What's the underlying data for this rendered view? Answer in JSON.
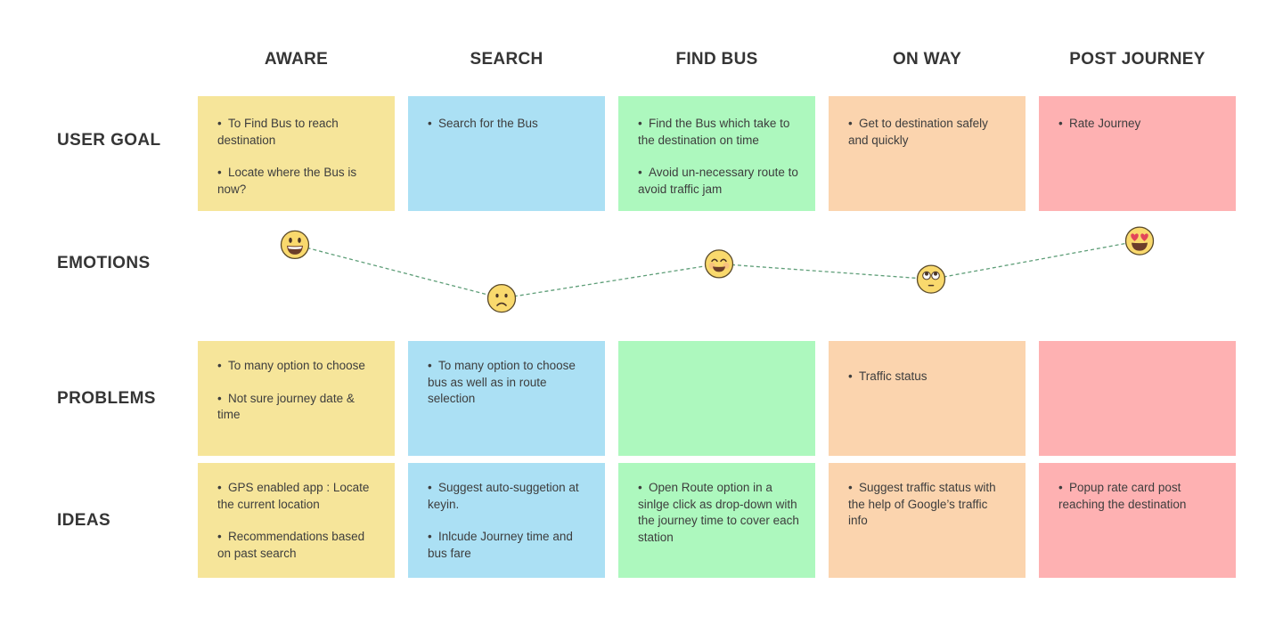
{
  "stages": [
    "AWARE",
    "SEARCH",
    "FIND BUS",
    "ON WAY",
    "POST JOURNEY"
  ],
  "stage_colors": [
    "#f6e59a",
    "#abe0f4",
    "#adf8be",
    "#fbd4ae",
    "#feb1b2"
  ],
  "row_labels": {
    "user_goal": "USER GOAL",
    "emotions": "EMOTIONS",
    "problems": "PROBLEMS",
    "ideas": "IDEAS"
  },
  "user_goal": [
    [
      "To Find Bus to reach destination",
      "Locate where the Bus is now?"
    ],
    [
      "Search for the Bus"
    ],
    [
      "Find the Bus which take to the destination on time",
      "Avoid un-necessary route to avoid traffic jam"
    ],
    [
      "Get to destination safely and quickly"
    ],
    [
      "Rate Journey"
    ]
  ],
  "emotions": [
    {
      "stage": "AWARE",
      "icon": "grinning-face-icon",
      "sentiment": "very happy",
      "level": 0.85
    },
    {
      "stage": "SEARCH",
      "icon": "frowning-face-icon",
      "sentiment": "sad",
      "level": 0.15
    },
    {
      "stage": "FIND BUS",
      "icon": "smiling-face-icon",
      "sentiment": "happy",
      "level": 0.6
    },
    {
      "stage": "ON WAY",
      "icon": "eye-roll-face-icon",
      "sentiment": "neutral",
      "level": 0.4
    },
    {
      "stage": "POST JOURNEY",
      "icon": "heart-eyes-face-icon",
      "sentiment": "delighted",
      "level": 0.9
    }
  ],
  "emotion_line_color": "#5e9e78",
  "problems": [
    [
      "To many option to choose",
      "Not sure journey date & time"
    ],
    [
      "To many option to choose bus as well as in route selection"
    ],
    [],
    [
      "Traffic status"
    ],
    []
  ],
  "ideas": [
    [
      "GPS enabled app : Locate the current location",
      "Recommendations based on past search"
    ],
    [
      "Suggest auto-suggetion at keyin.",
      "Inlcude Journey time and bus fare"
    ],
    [
      "Open Route option in a sinlge click as drop-down with the journey time to cover each station"
    ],
    [
      "Suggest traffic status with the help of Google’s traffic info"
    ],
    [
      "Popup rate card post reaching the destination"
    ]
  ],
  "bullet_char": "•"
}
